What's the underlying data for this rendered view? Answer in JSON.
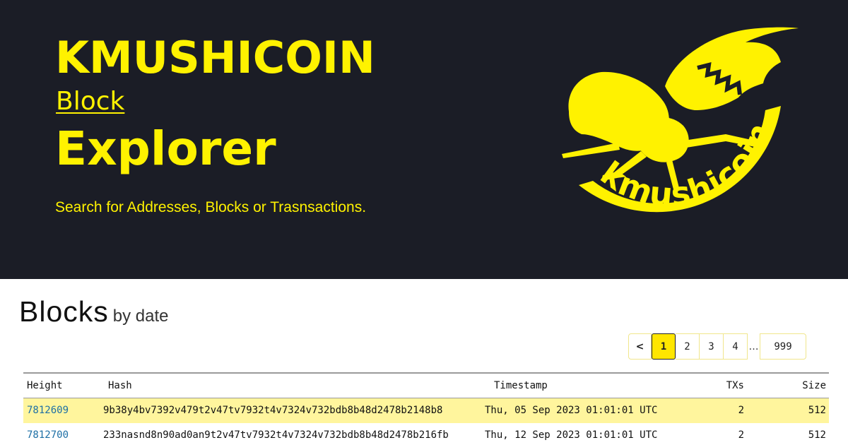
{
  "hero": {
    "brand": "KMUSHICOIN",
    "block_word": "Block",
    "explorer_word": "Explorer",
    "tagline": "Search for Addresses, Blocks or Trasnsactions.",
    "logo_text": "kmushicoin"
  },
  "colors": {
    "accent": "#fff200",
    "hero_bg": "#1b1d26",
    "row_highlight": "#fff59d",
    "link": "#1d6fa5"
  },
  "section": {
    "title": "Blocks",
    "subtitle": "by date"
  },
  "pagination": {
    "prev": "<",
    "pages": [
      "1",
      "2",
      "3",
      "4"
    ],
    "active": "1",
    "ellipsis": "…",
    "last": "999"
  },
  "table": {
    "columns": [
      "Height",
      "Hash",
      "Timestamp",
      "TXs",
      "Size"
    ],
    "rows": [
      {
        "height": "7812609",
        "hash": "9b38y4bv7392v479t2v47tv7932t4v7324v732bdb8b48d2478b2148b8",
        "timestamp": "Thu, 05 Sep 2023 01:01:01 UTC",
        "txs": "2",
        "size": "512"
      },
      {
        "height": "7812700",
        "hash": "233nasnd8n90ad0an9t2v47tv7932t4v7324v732bdb8b48d2478b216fb",
        "timestamp": "Thu, 12 Sep 2023 01:01:01 UTC",
        "txs": "2",
        "size": "512"
      }
    ]
  }
}
